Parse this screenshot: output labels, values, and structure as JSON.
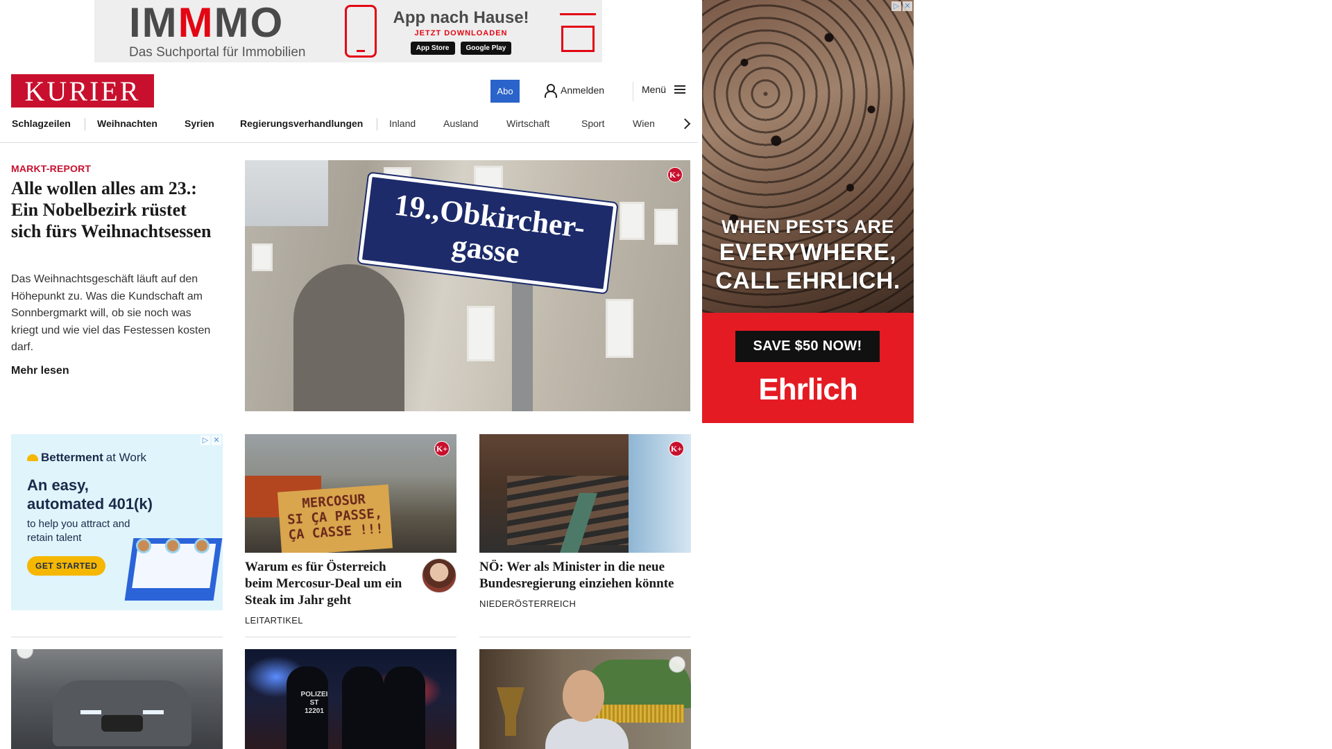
{
  "top_ad": {
    "brand_prefix": "IM",
    "brand_accent": "M",
    "brand_suffix": "MO",
    "tagline": "Das Suchportal für Immobilien",
    "headline": "App nach Hause!",
    "cta": "JETZT DOWNLOADEN",
    "store_apple": "App Store",
    "store_google": "Google Play"
  },
  "header": {
    "logo": "KURIER",
    "abo": "Abo",
    "login": "Anmelden",
    "menu": "Menü",
    "brand_color": "#c8102e",
    "accent_color": "#2a63c9"
  },
  "nav": {
    "items": [
      "Schlagzeilen",
      "Weihnachten",
      "Syrien",
      "Regierungsverhandlungen",
      "Inland",
      "Ausland",
      "Wirtschaft",
      "Sport",
      "Wien"
    ]
  },
  "lead": {
    "kicker": "MARKT-REPORT",
    "title": "Alle wollen alles am 23.: Ein Nobelbezirk rüstet sich fürs Weihnachtsessen",
    "text": "Das Weihnachtsgeschäft läuft auf den Höhepunkt zu. Was die Kundschaft am Sonnbergmarkt will, ob sie noch was kriegt und wie viel das Festessen kosten darf.",
    "more": "Mehr lesen",
    "sign_line1": "19.,Obkircher-",
    "sign_line2": "gasse",
    "badge": "K+"
  },
  "betterment_ad": {
    "brand": "Betterment",
    "brand_suffix": "at Work",
    "headline": "An easy, automated 401(k)",
    "sub": "to help you attract and retain talent",
    "button": "GET STARTED"
  },
  "cards": [
    {
      "title": "Warum es für Österreich beim Mercosur-Deal um ein Steak im Jahr geht",
      "label": "LEITARTIKEL",
      "sign_text": "MERCOSUR\nSI ÇA PASSE,\nÇA CASSE !!!",
      "badge": "K+"
    },
    {
      "title": "NÖ: Wer als Minister in die neue Bundesregierung einziehen könnte",
      "label": "NIEDERÖSTERREICH",
      "badge": "K+"
    }
  ],
  "police_card": {
    "tag": "POLIZEI ST 12201"
  },
  "right_ad": {
    "line1": "WHEN PESTS ARE",
    "line2": "EVERYWHERE,",
    "line3": "CALL EHRLICH.",
    "button": "SAVE $50 NOW!",
    "brand": "Ehrlich",
    "brand_color": "#e41b23"
  }
}
